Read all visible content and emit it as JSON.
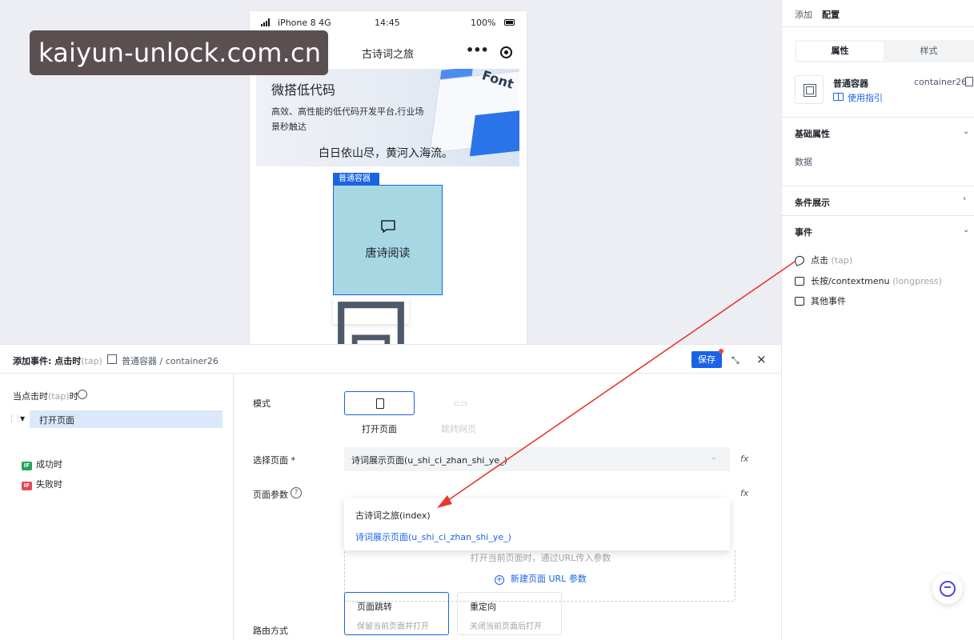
{
  "watermark": "kaiyun-unlock.com.cn",
  "phone": {
    "carrier": "iPhone 8  4G",
    "time": "14:45",
    "battery": "100%",
    "nav_title": "古诗词之旅",
    "banner": {
      "title": "微搭低代码",
      "subtitle": "高效、高性能的低代码开发平台,行业场景秒触达",
      "poem": "白日依山尽，黄河入海流。",
      "deco_text": "Font"
    },
    "container_tag": "普通容器",
    "container_label": "唐诗阅读"
  },
  "right_panel": {
    "tabs": [
      "添加",
      "配置"
    ],
    "active_tab": "配置",
    "segments": [
      "属性",
      "样式"
    ],
    "component_name": "普通容器",
    "component_id": "container26",
    "guide_link": "使用指引",
    "sections": {
      "basic": "基础属性",
      "data": "数据",
      "condition": "条件展示",
      "events": "事件"
    },
    "events": [
      {
        "label": "点击",
        "sub": "(tap)"
      },
      {
        "label": "长按/contextmenu",
        "sub": "(longpress)"
      },
      {
        "label": "其他事件",
        "sub": ""
      }
    ]
  },
  "dialog": {
    "title": "添加事件: 点击时",
    "title_tap": "(tap)",
    "component_path": "普通容器 / container26",
    "save_label": "保存",
    "trigger": "当点击时",
    "trigger_tap": "(tap)",
    "trigger_suffix": "时",
    "action": "打开页面",
    "branches": [
      {
        "badge": "IF",
        "label": "成功时",
        "color": "#22a559"
      },
      {
        "badge": "IF",
        "label": "失败时",
        "color": "#e54856"
      }
    ],
    "form": {
      "mode_label": "模式",
      "modes": [
        {
          "label": "打开页面",
          "active": true
        },
        {
          "label": "跳转网页",
          "active": false
        }
      ],
      "page_label": "选择页面 *",
      "page_value": "诗词展示页面(u_shi_ci_zhan_shi_ye_)",
      "fx": "fx",
      "params_label": "页面参数",
      "dropdown_options": [
        "古诗词之旅(index)",
        "诗词展示页面(u_shi_ci_zhan_shi_ye_)"
      ],
      "url_hint": "打开当前页面时，通过URL传入参数",
      "url_add": "新建页面 URL 参数",
      "route_label": "路由方式",
      "routes": [
        {
          "title": "页面跳转",
          "desc": "保留当前页面并打开"
        },
        {
          "title": "重定向",
          "desc": "关闭当前页面后打开"
        }
      ]
    }
  },
  "colors": {
    "accent": "#1a63e6",
    "arrow": "#e5382e",
    "container_fill": "#a6d7e3"
  }
}
